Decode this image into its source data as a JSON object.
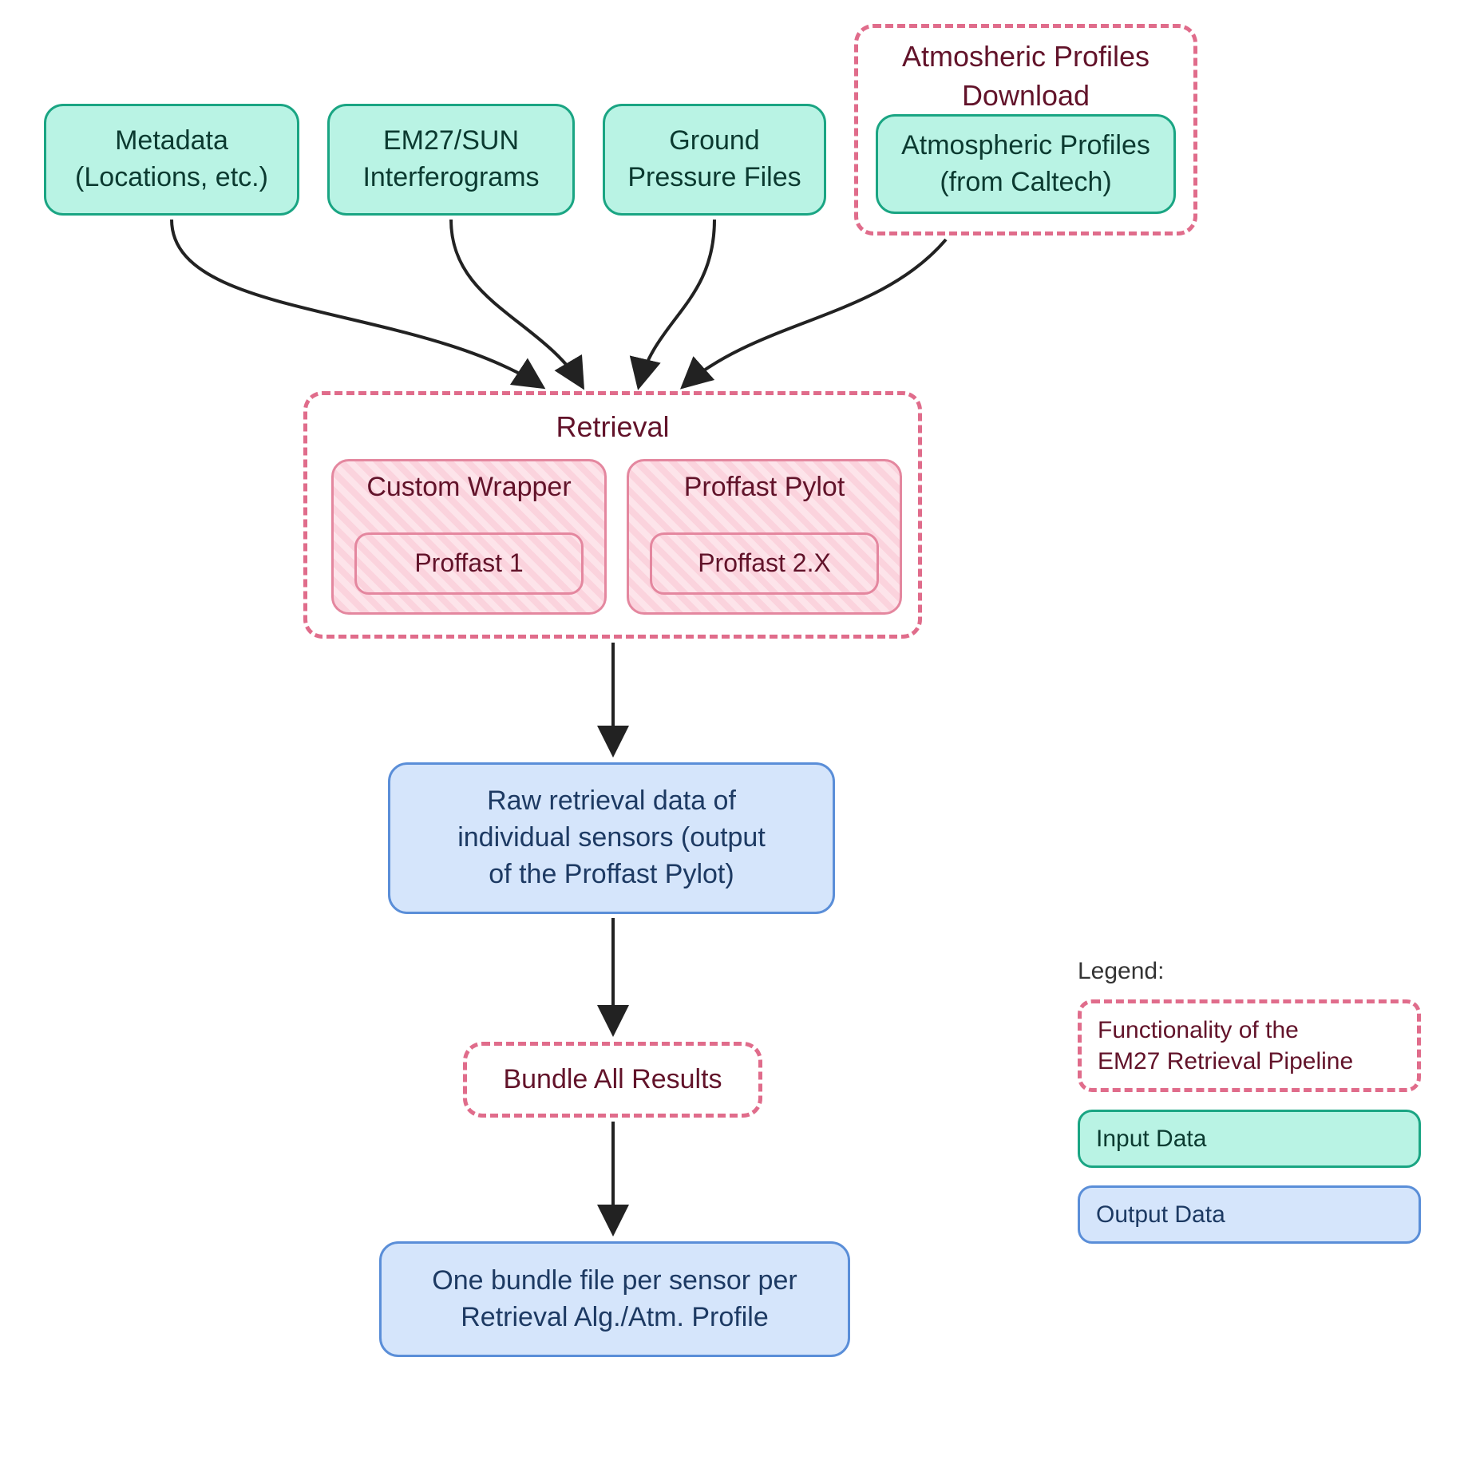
{
  "inputs": {
    "metadata": "Metadata\n(Locations, etc.)",
    "interferograms": "EM27/SUN\nInterferograms",
    "ground_pressure": "Ground\nPressure Files",
    "atm_profiles": "Atmospheric Profiles\n(from Caltech)"
  },
  "pipeline": {
    "atm_download_title": "Atmosheric Profiles\nDownload",
    "retrieval_title": "Retrieval",
    "custom_wrapper": "Custom Wrapper",
    "proffast1": "Proffast 1",
    "proffast_pylot": "Proffast Pylot",
    "proffast2x": "Proffast 2.X",
    "bundle_all": "Bundle All Results"
  },
  "outputs": {
    "raw_retrieval": "Raw retrieval data of\nindividual sensors (output\nof the Proffast Pylot)",
    "bundle_file": "One bundle file per sensor per\nRetrieval Alg./Atm. Profile"
  },
  "legend": {
    "title": "Legend:",
    "pipeline": "Functionality of the\nEM27 Retrieval Pipeline",
    "input": "Input Data",
    "output": "Output Data"
  }
}
